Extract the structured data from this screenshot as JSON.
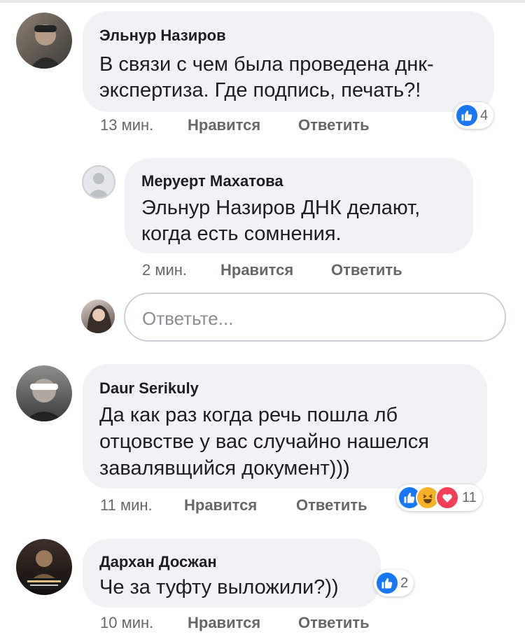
{
  "comments": [
    {
      "author": "Эльнур Назиров",
      "lines": [
        "В связи с чем была проведена днк-",
        "экспертиза. Где подпись, печать?!"
      ],
      "time": "13 мин.",
      "like": "Нравится",
      "reply": "Ответить",
      "reactions": {
        "icons": [
          "like-icon"
        ],
        "count": "4"
      }
    },
    {
      "author": "Меруерт Махатова",
      "lines": [
        "Эльнур Назиров ДНК делают,",
        "когда есть сомнения."
      ],
      "time": "2 мин.",
      "like": "Нравится",
      "reply": "Ответить"
    },
    {
      "author": "Daur Serikuly",
      "lines": [
        "Да как раз когда речь пошла лб",
        "отцовстве у вас случайно нашелся",
        "завалявщийся документ)))"
      ],
      "time": "11 мин.",
      "like": "Нравится",
      "reply": "Ответить",
      "reactions": {
        "icons": [
          "like-icon",
          "haha-icon",
          "love-icon"
        ],
        "count": "11"
      }
    },
    {
      "author": "Дархан Досжан",
      "lines": [
        "Че за туфту выложили?))"
      ],
      "time": "10 мин.",
      "like": "Нравится",
      "reply": "Ответить",
      "reactions": {
        "icons": [
          "like-icon"
        ],
        "count": "2"
      }
    }
  ],
  "reply_box": {
    "placeholder": "Ответьте..."
  },
  "colors": {
    "bubble": "#f0f2f5",
    "meta": "#65676b",
    "like_blue": "#1877f2",
    "love_red": "#f33e58",
    "haha_yellow": "#f7b125"
  }
}
